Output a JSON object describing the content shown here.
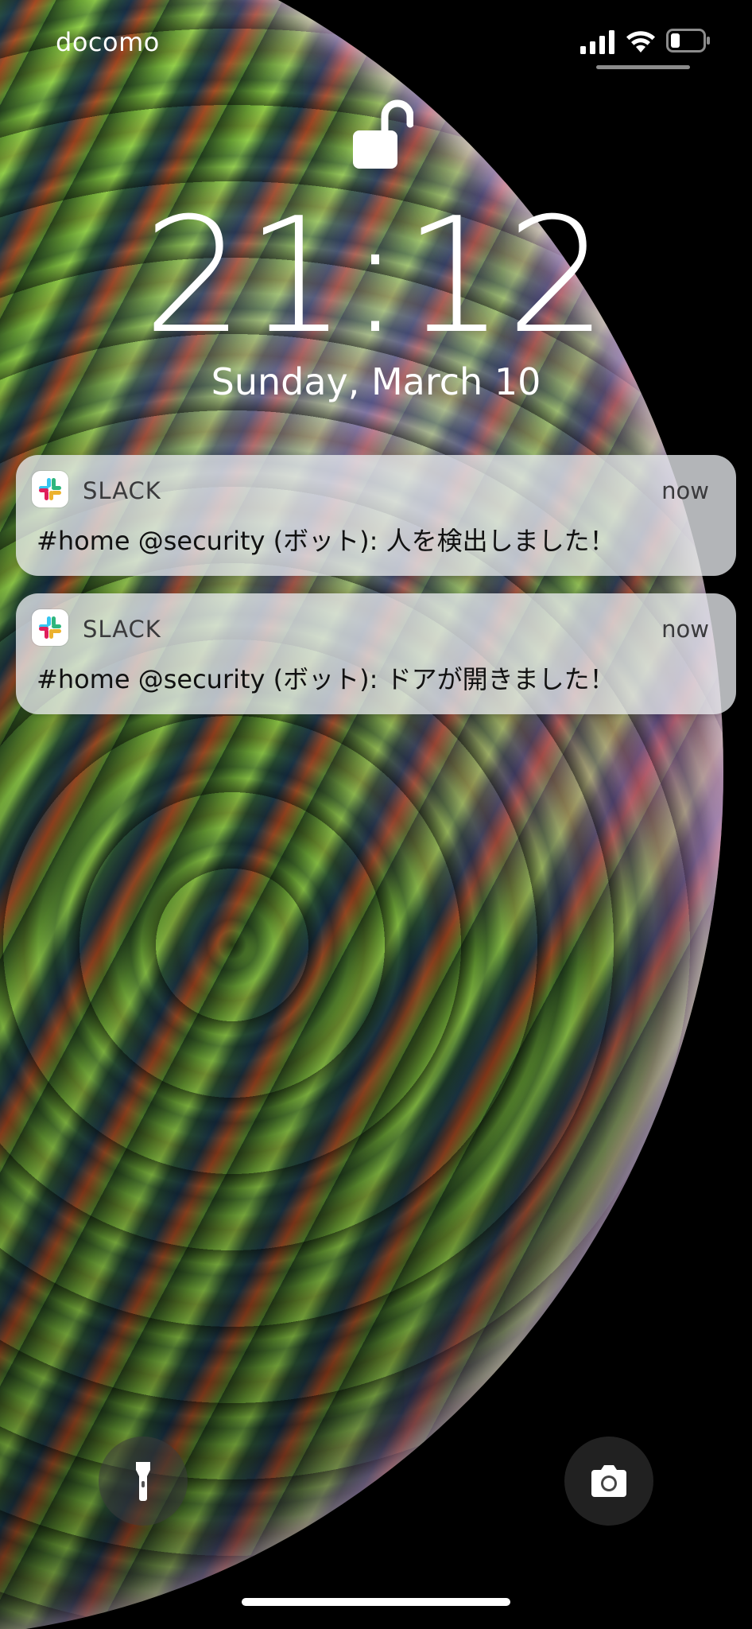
{
  "status_bar": {
    "carrier": "docomo",
    "icons": [
      "signal-icon",
      "wifi-icon",
      "battery-icon"
    ],
    "battery_level": 0.25
  },
  "lock_screen": {
    "lock_state": "unlocked",
    "time": "21:12",
    "date": "Sunday, March 10"
  },
  "notifications": [
    {
      "app_name": "SLACK",
      "time": "now",
      "body": "#home @security (ボット): 人を検出しました！"
    },
    {
      "app_name": "SLACK",
      "time": "now",
      "body": "#home @security (ボット): ドアが開きました！"
    }
  ],
  "quick_actions": {
    "left": "flashlight-icon",
    "right": "camera-icon"
  },
  "colors": {
    "notification_bg": "#E6E8EC",
    "slack_blue": "#36C5F0",
    "slack_green": "#2EB67D",
    "slack_yellow": "#ECB22E",
    "slack_red": "#E01E5A"
  }
}
